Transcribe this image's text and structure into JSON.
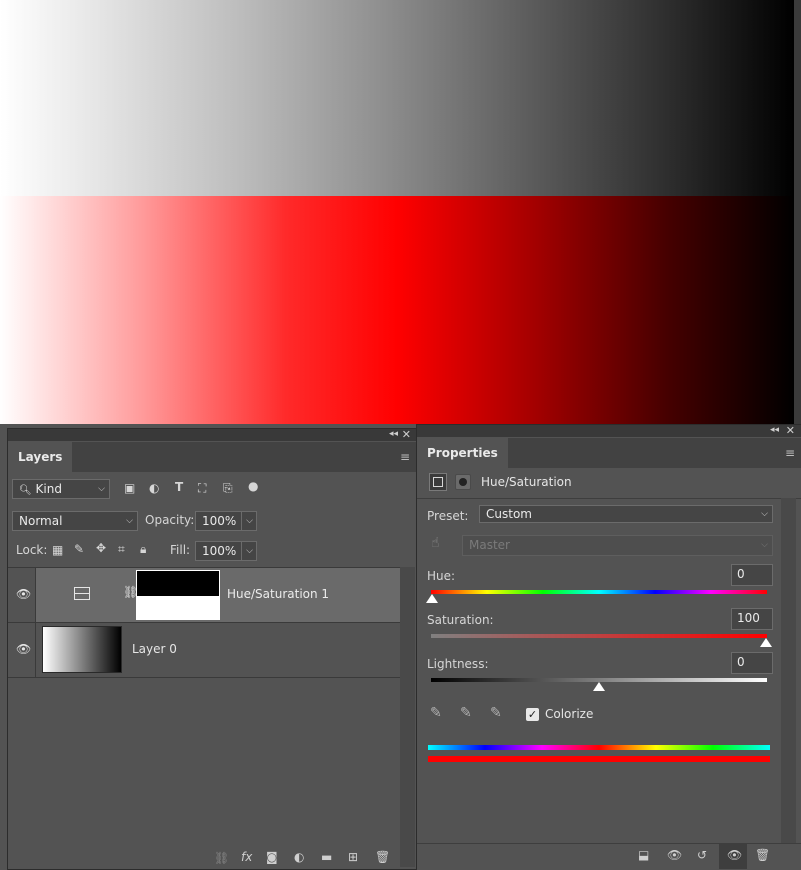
{
  "layers_panel": {
    "tab_label": "Layers",
    "filter": {
      "label": "Kind",
      "icons": [
        "pixel-filter-icon",
        "adjustment-filter-icon",
        "type-filter-icon",
        "shape-filter-icon",
        "smart-object-filter-icon",
        "filter-toggle-icon"
      ]
    },
    "blend_mode": "Normal",
    "opacity_label": "Opacity:",
    "opacity_value": "100%",
    "lock_label": "Lock:",
    "fill_label": "Fill:",
    "fill_value": "100%",
    "layers": [
      {
        "name": "Hue/Saturation 1",
        "type": "adjustment",
        "selected": true,
        "visible": true
      },
      {
        "name": "Layer 0",
        "type": "pixel",
        "selected": false,
        "visible": true
      }
    ],
    "footer_icons": [
      "link-layers-icon",
      "fx-icon",
      "add-mask-icon",
      "new-adjustment-icon",
      "new-group-icon",
      "new-layer-icon",
      "delete-layer-icon"
    ],
    "fx_label": "fx"
  },
  "properties_panel": {
    "tab_label": "Properties",
    "adjustment_title": "Hue/Saturation",
    "preset_label": "Preset:",
    "preset_value": "Custom",
    "channel_value": "Master",
    "hue_label": "Hue:",
    "hue_value": "0",
    "saturation_label": "Saturation:",
    "saturation_value": "100",
    "lightness_label": "Lightness:",
    "lightness_value": "0",
    "colorize_label": "Colorize",
    "colorize_checked": true,
    "footer_icons": [
      "clip-to-layer-icon",
      "view-previous-state-icon",
      "reset-icon",
      "toggle-visibility-icon",
      "delete-icon"
    ]
  },
  "colors": {
    "accent_red": "#ff0000",
    "panel_bg": "#535353"
  }
}
